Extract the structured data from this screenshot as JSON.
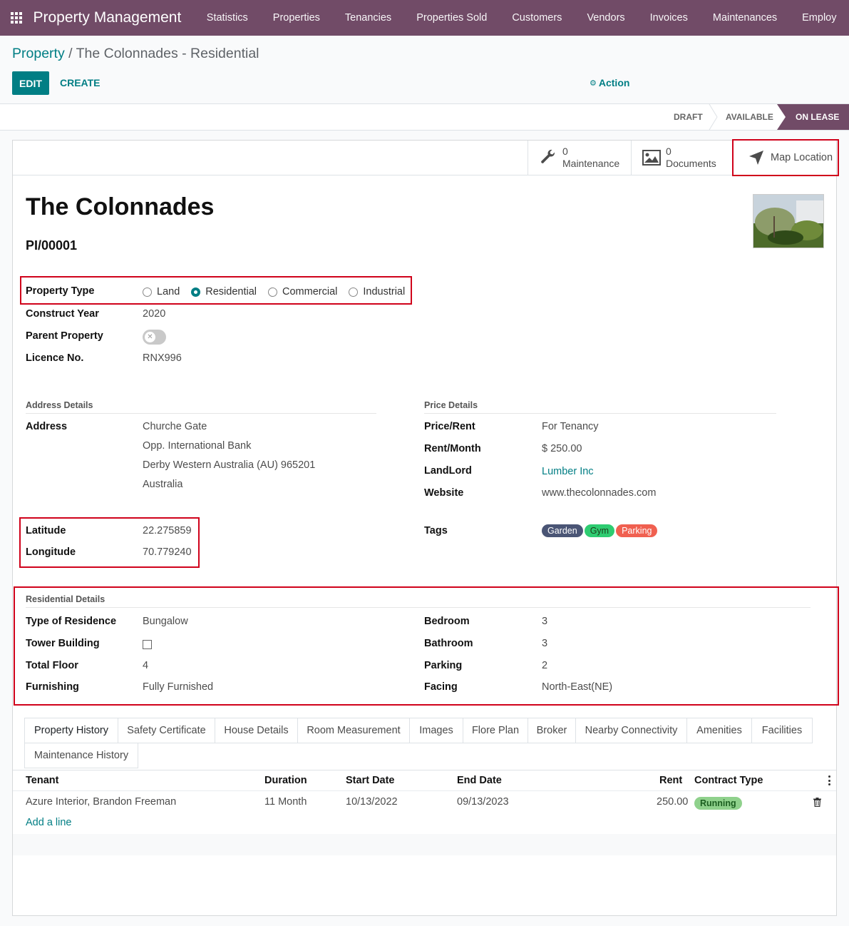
{
  "nav": {
    "brand": "Property Management",
    "menu": [
      "Statistics",
      "Properties",
      "Tenancies",
      "Properties Sold",
      "Customers",
      "Vendors",
      "Invoices",
      "Maintenances",
      "Employ"
    ]
  },
  "breadcrumb": {
    "root": "Property",
    "separator": " / ",
    "current": "The Colonnades - Residential"
  },
  "toolbar": {
    "edit_label": "EDIT",
    "create_label": "CREATE",
    "action_label": "Action"
  },
  "statusbar": {
    "stages": [
      "DRAFT",
      "AVAILABLE",
      "ON LEASE"
    ],
    "active": "ON LEASE"
  },
  "smart_buttons": {
    "maintenance": {
      "count": "0",
      "label": "Maintenance"
    },
    "documents": {
      "count": "0",
      "label": "Documents"
    },
    "map": {
      "label": "Map Location"
    }
  },
  "property": {
    "name": "The Colonnades",
    "ref": "PI/00001",
    "property_type_label": "Property Type",
    "property_type_options": [
      "Land",
      "Residential",
      "Commercial",
      "Industrial"
    ],
    "property_type_selected": "Residential",
    "construct_year_label": "Construct Year",
    "construct_year": "2020",
    "parent_property_label": "Parent Property",
    "licence_label": "Licence No.",
    "licence": "RNX996"
  },
  "address": {
    "section_title": "Address Details",
    "label": "Address",
    "lines": [
      "Churche Gate",
      "Opp. International Bank",
      "Derby  Western Australia (AU)  965201",
      "Australia"
    ],
    "latitude_label": "Latitude",
    "latitude": "22.275859",
    "longitude_label": "Longitude",
    "longitude": "70.779240"
  },
  "price": {
    "section_title": "Price Details",
    "price_rent_label": "Price/Rent",
    "price_rent": "For Tenancy",
    "rent_month_label": "Rent/Month",
    "rent_month": "$ 250.00",
    "landlord_label": "LandLord",
    "landlord": "Lumber Inc",
    "website_label": "Website",
    "website": "www.thecolonnades.com",
    "tags_label": "Tags",
    "tags": [
      {
        "name": "Garden",
        "color": "#4a5575"
      },
      {
        "name": "Gym",
        "color": "#2ecc71"
      },
      {
        "name": "Parking",
        "color": "#f06050"
      }
    ]
  },
  "residential": {
    "section_title": "Residential Details",
    "type_label": "Type of Residence",
    "type": "Bungalow",
    "tower_label": "Tower Building",
    "total_floor_label": "Total Floor",
    "total_floor": "4",
    "furnishing_label": "Furnishing",
    "furnishing": "Fully Furnished",
    "bedroom_label": "Bedroom",
    "bedroom": "3",
    "bathroom_label": "Bathroom",
    "bathroom": "3",
    "parking_label": "Parking",
    "parking": "2",
    "facing_label": "Facing",
    "facing": "North-East(NE)"
  },
  "tabs": [
    "Property History",
    "Safety Certificate",
    "House Details",
    "Room Measurement",
    "Images",
    "Flore Plan",
    "Broker",
    "Nearby Connectivity",
    "Amenities",
    "Facilities",
    "Maintenance History"
  ],
  "table": {
    "headers": [
      "Tenant",
      "Duration",
      "Start Date",
      "End Date",
      "Rent",
      "Contract Type"
    ],
    "rows": [
      {
        "tenant": "Azure Interior, Brandon Freeman",
        "duration": "11 Month",
        "start": "10/13/2022",
        "end": "09/13/2023",
        "rent": "250.00",
        "contract": "Running"
      }
    ],
    "add_line": "Add a line"
  },
  "colors": {
    "brand": "#714b67",
    "accent": "#017e84",
    "highlight": "#d0021b"
  }
}
